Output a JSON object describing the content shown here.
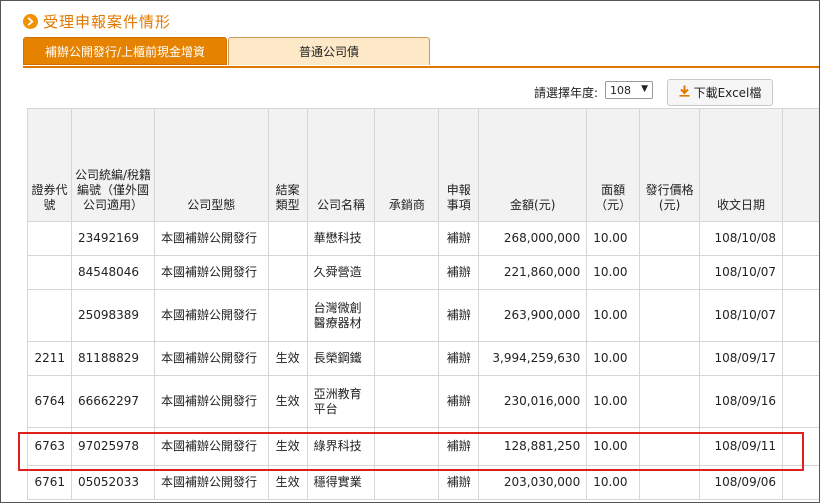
{
  "header": {
    "title": "受理申報案件情形"
  },
  "tabs": [
    {
      "label": "補辦公開發行/上櫃前現金增資"
    },
    {
      "label": "普通公司債"
    }
  ],
  "toolbar": {
    "year_label": "請選擇年度:",
    "year_value": "108",
    "download_label": "下載Excel檔"
  },
  "table": {
    "headers": [
      "證券代號",
      "公司統編/稅籍編號（僅外國公司適用）",
      "公司型態",
      "結案類型",
      "公司名稱",
      "承銷商",
      "申報事項",
      "金額(元)",
      "面額（元）",
      "發行價格(元)",
      "收文日期"
    ],
    "rows": [
      [
        "",
        "23492169",
        "本國補辦公開發行",
        "",
        "華懋科技",
        "",
        "補辦",
        "268,000,000",
        "10.00",
        "",
        "108/10/08"
      ],
      [
        "",
        "84548046",
        "本國補辦公開發行",
        "",
        "久舜營造",
        "",
        "補辦",
        "221,860,000",
        "10.00",
        "",
        "108/10/07"
      ],
      [
        "",
        "25098389",
        "本國補辦公開發行",
        "",
        "台灣微創醫療器材",
        "",
        "補辦",
        "263,900,000",
        "10.00",
        "",
        "108/10/07"
      ],
      [
        "2211",
        "81188829",
        "本國補辦公開發行",
        "生效",
        "長榮鋼鐵",
        "",
        "補辦",
        "3,994,259,630",
        "10.00",
        "",
        "108/09/17"
      ],
      [
        "6764",
        "66662297",
        "本國補辦公開發行",
        "生效",
        "亞洲教育平台",
        "",
        "補辦",
        "230,016,000",
        "10.00",
        "",
        "108/09/16"
      ],
      [
        "6763",
        "97025978",
        "本國補辦公開發行",
        "生效",
        "綠界科技",
        "",
        "補辦",
        "128,881,250",
        "10.00",
        "",
        "108/09/11"
      ],
      [
        "6761",
        "05052033",
        "本國補辦公開發行",
        "生效",
        "穩得實業",
        "",
        "補辦",
        "203,030,000",
        "10.00",
        "",
        "108/09/06"
      ]
    ]
  },
  "colors": {
    "accent": "#e58200",
    "tab_inactive": "#fde9c8",
    "highlight": "#e0201e"
  }
}
